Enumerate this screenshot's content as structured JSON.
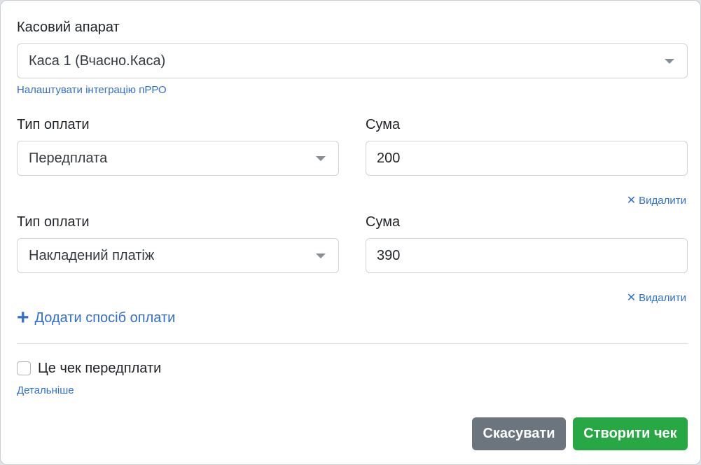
{
  "register": {
    "label": "Касовий апарат",
    "selected": "Каса 1 (Вчасно.Каса)",
    "setup_link": "Налаштувати інтеграцію пРРО"
  },
  "payments": [
    {
      "type_label": "Тип оплати",
      "type_value": "Передплата",
      "amount_label": "Сума",
      "amount_value": "200",
      "remove_label": "Видалити"
    },
    {
      "type_label": "Тип оплати",
      "type_value": "Накладений платіж",
      "amount_label": "Сума",
      "amount_value": "390",
      "remove_label": "Видалити"
    }
  ],
  "add_payment_label": "Додати спосіб оплати",
  "prepayment": {
    "label": "Це чек передплати",
    "checked": false,
    "details_link": "Детальніше"
  },
  "buttons": {
    "cancel": "Скасувати",
    "create": "Створити чек"
  },
  "colors": {
    "link": "#2f6fd1",
    "cancel_button": "#6c757d",
    "create_button": "#28a745"
  }
}
